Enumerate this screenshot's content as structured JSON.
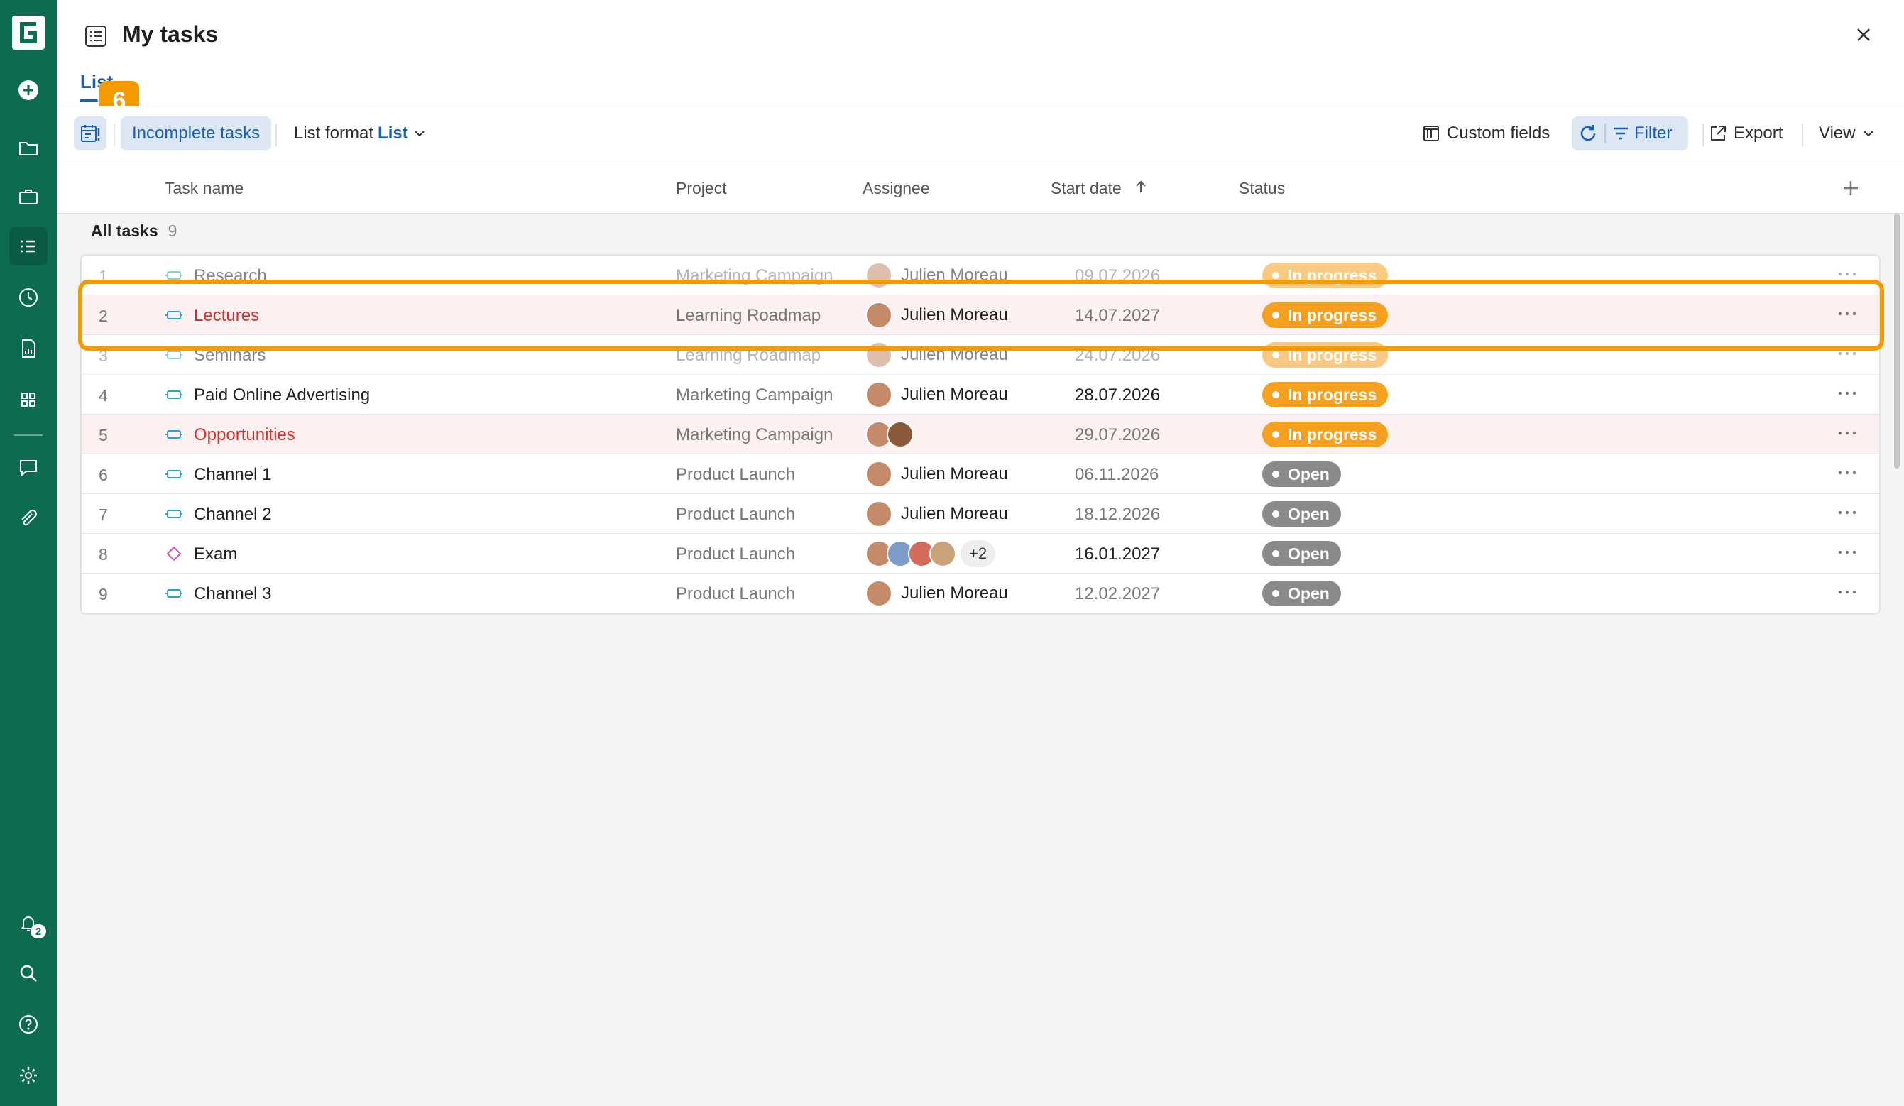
{
  "sidebar": {
    "notification_count": "2"
  },
  "header": {
    "title": "My tasks",
    "tab_label": "List",
    "step_badge": "6"
  },
  "toolbar": {
    "incomplete_label": "Incomplete tasks",
    "list_format_label": "List format",
    "list_format_value": "List",
    "custom_fields_label": "Custom fields",
    "filter_label": "Filter",
    "export_label": "Export",
    "view_label": "View"
  },
  "table": {
    "columns": {
      "task_name": "Task name",
      "project": "Project",
      "assignee": "Assignee",
      "start_date": "Start date",
      "status": "Status"
    },
    "group_label": "All tasks",
    "group_count": "9",
    "rows": [
      {
        "num": "1",
        "name": "Research",
        "project": "Marketing Campaign",
        "assignee": "Julien Moreau",
        "date": "09.07.2026",
        "status": "In progress"
      },
      {
        "num": "2",
        "name": "Lectures",
        "project": "Learning Roadmap",
        "assignee": "Julien Moreau",
        "date": "14.07.2027",
        "status": "In progress"
      },
      {
        "num": "3",
        "name": "Seminars",
        "project": "Learning Roadmap",
        "assignee": "Julien Moreau",
        "date": "24.07.2026",
        "status": "In progress"
      },
      {
        "num": "4",
        "name": "Paid Online Advertising",
        "project": "Marketing Campaign",
        "assignee": "Julien Moreau",
        "date": "28.07.2026",
        "status": "In progress"
      },
      {
        "num": "5",
        "name": "Opportunities",
        "project": "Marketing Campaign",
        "assignee": "",
        "date": "29.07.2026",
        "status": "In progress"
      },
      {
        "num": "6",
        "name": "Channel 1",
        "project": "Product Launch",
        "assignee": "Julien Moreau",
        "date": "06.11.2026",
        "status": "Open"
      },
      {
        "num": "7",
        "name": "Channel 2",
        "project": "Product Launch",
        "assignee": "Julien Moreau",
        "date": "18.12.2026",
        "status": "Open"
      },
      {
        "num": "8",
        "name": "Exam",
        "project": "Product Launch",
        "assignee_more": "+2",
        "date": "16.01.2027",
        "status": "Open"
      },
      {
        "num": "9",
        "name": "Channel 3",
        "project": "Product Launch",
        "assignee": "Julien Moreau",
        "date": "12.02.2027",
        "status": "Open"
      }
    ]
  },
  "colors": {
    "sidebar_bg": "#0d6b52",
    "accent_blue": "#1a5fb4",
    "status_in_progress": "#f6a020",
    "status_open": "#8a8a8a",
    "highlight_orange": "#f59b00",
    "overdue_red": "#d32f2f"
  }
}
